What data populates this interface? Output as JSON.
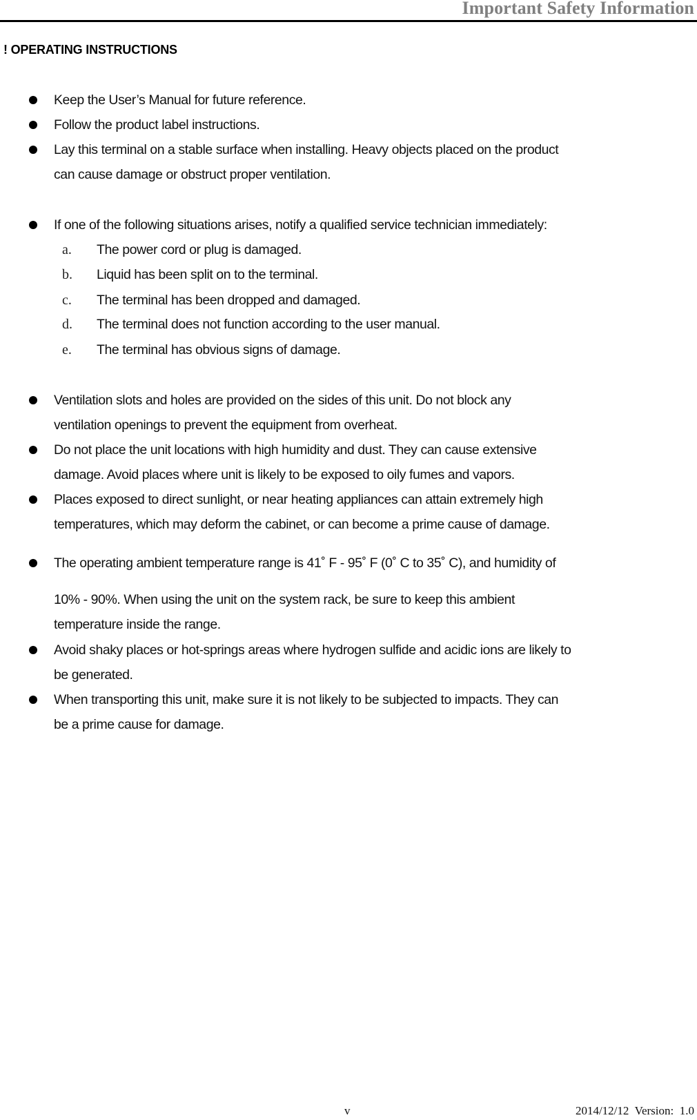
{
  "header": {
    "title": "Important Safety Information"
  },
  "section": {
    "heading": "! OPERATING INSTRUCTIONS"
  },
  "bullets": [
    {
      "text": "Keep the User’s Manual for future reference."
    },
    {
      "text": "Follow the product label instructions."
    },
    {
      "text": "Lay this terminal on a stable surface when installing. Heavy objects placed on the product\ncan cause damage or obstruct proper ventilation."
    },
    {
      "text": "If one of the following situations arises, notify a qualified service technician immediately:"
    },
    {
      "text": "Ventilation slots and holes are provided on the sides of this unit. Do not block any\nventilation openings to prevent the equipment from overheat."
    },
    {
      "text": "Do not place the unit locations with high humidity and dust. They can cause extensive\ndamage. Avoid places where unit is likely to be exposed to oily fumes and vapors."
    },
    {
      "text": "Places exposed to direct sunlight, or near heating appliances can attain extremely high\ntemperatures, which may deform the cabinet, or can become a prime cause of damage."
    },
    {
      "text": "The operating ambient temperature range is 41˚ F - 95˚ F (0˚ C to 35˚ C), and humidity of"
    },
    {
      "text": "10% - 90%. When using the unit on the system rack, be sure to keep this ambient\ntemperature inside the range."
    },
    {
      "text": "Avoid shaky places or hot-springs areas where hydrogen sulfide and acidic ions are likely to\nbe generated."
    },
    {
      "text": "When transporting this unit, make sure it is not likely to be subjected to impacts. They can\nbe a prime cause for damage."
    }
  ],
  "sub_items": [
    {
      "marker": "a.",
      "text": "The power cord or plug is damaged."
    },
    {
      "marker": "b.",
      "text": "Liquid has been split on to the terminal."
    },
    {
      "marker": "c.",
      "text": "The terminal has been dropped and damaged."
    },
    {
      "marker": "d.",
      "text": "The terminal does not function according to the user manual."
    },
    {
      "marker": "e.",
      "text": "The terminal has obvious signs of damage."
    }
  ],
  "footer": {
    "page_number": "v",
    "date_version": "2014/12/12  Version:  1.0"
  }
}
